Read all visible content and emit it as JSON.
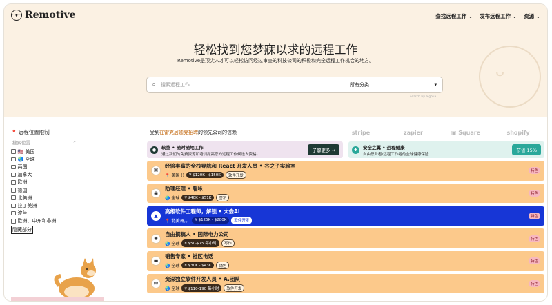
{
  "brand": {
    "name": "Remotive",
    "logo_icon": "dog-face-icon"
  },
  "nav": {
    "items": [
      "查找远程工作 ⌄",
      "发布远程工作 ⌄",
      "资源 ⌄"
    ]
  },
  "hero": {
    "title": "轻松找到您梦寐以求的远程工作",
    "subtitle": "Remotive是顶尖人才可以轻松访问经过审查的科技公司的积极和完全远程工作机会的地方。"
  },
  "search": {
    "placeholder": "搜索远程工作…",
    "category": "所有分类",
    "powered_by": "search by algolia"
  },
  "sidebar": {
    "title": "远程位置限制",
    "search_placeholder": "搜索位置…",
    "locations": [
      "🇺🇸 美国",
      "🌏 全球",
      "英国",
      "加拿大",
      "欧洲",
      "德国",
      "北美洲",
      "拉丁美洲",
      "波兰",
      "欧洲、中东和非洲"
    ],
    "hide_label": "隐藏部分"
  },
  "trust": {
    "prefix": "受到",
    "link": "在雷克居迪克招聘",
    "suffix": "的领先公司的信赖",
    "brands": [
      "stripe",
      "zapier",
      "▣ Square",
      "shopify"
    ]
  },
  "promos": [
    {
      "icon": "●",
      "title": "软垫 • 随时随地工作",
      "desc": "通过我们的免费资源和培训提高您的远程工作候选人资格。",
      "button": "了解更多 →"
    },
    {
      "icon": "✚",
      "title": "安全之翼 • 远程健康",
      "desc": "自由职业者/远程工作者的全球健康保险",
      "button": "节省 15%"
    }
  ],
  "jobs": [
    {
      "logo": "⌘",
      "title": "经验丰富的全栈导航和 React 开发人员 • 谷之子实验室",
      "loc": "📍 美国 ()",
      "salary": "¥ $120K - $150K",
      "tag": "软件开发",
      "badge": "特色"
    },
    {
      "logo": "◉",
      "title": "助理经理 • 聪咏",
      "loc": "🌏 全球",
      "salary": "¥ $40K - $51K",
      "tag": "营销",
      "badge": "特色"
    },
    {
      "logo": "▲",
      "title": "高级软件工程师，解锁 • 大会AI",
      "loc": "📍 北美洲，。",
      "salary": "¥ $125K - $280K",
      "tag": "软件开发",
      "badge": "特色"
    },
    {
      "logo": "✺",
      "title": "自由撰稿人 • 国际电力公司",
      "loc": "🌏 全球",
      "salary": "¥ $50-$75 每小时",
      "tag": "写作",
      "badge": "特色"
    },
    {
      "logo": "▬",
      "title": "销售专家 • 社区电话",
      "loc": "🌏 全球",
      "salary": "¥ $30K - $43K",
      "tag": "销售",
      "badge": "特色"
    },
    {
      "logo": "W",
      "title": "资深独立软件开发人员 • A.团队",
      "loc": "🌏 全球",
      "salary": "¥ $110-190 每小时",
      "tag": "软件开发",
      "badge": "特色"
    }
  ]
}
